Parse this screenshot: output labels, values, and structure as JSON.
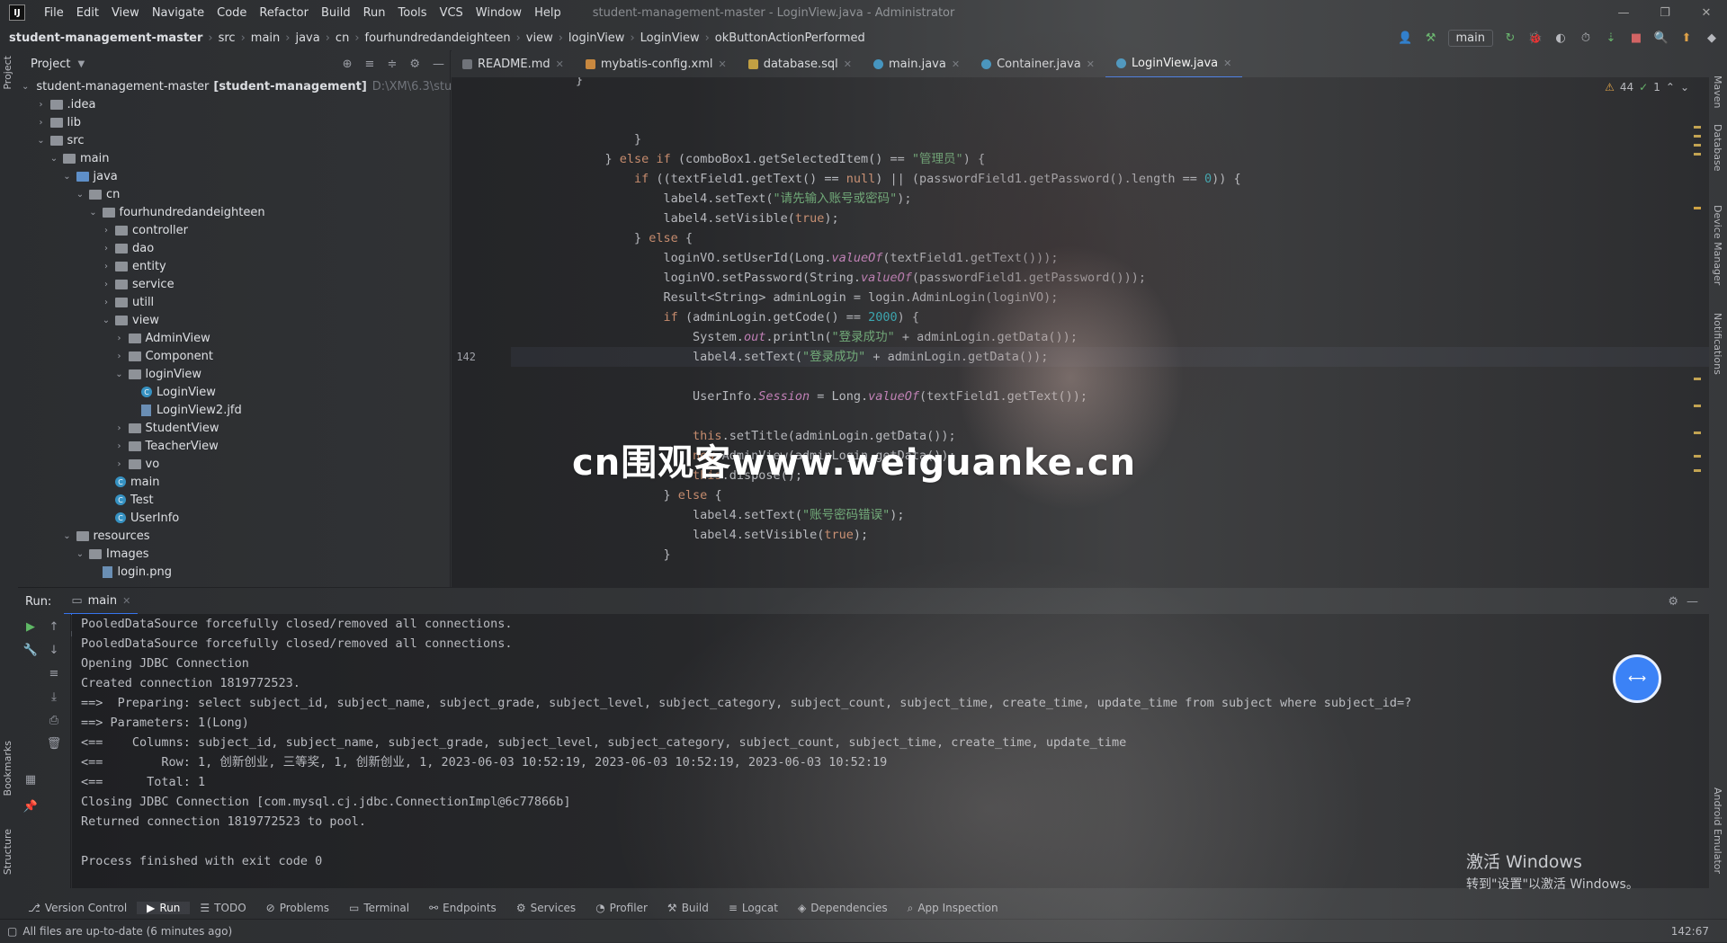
{
  "titlebar": {
    "logo": "IJ",
    "menu": [
      "File",
      "Edit",
      "View",
      "Navigate",
      "Code",
      "Refactor",
      "Build",
      "Run",
      "Tools",
      "VCS",
      "Window",
      "Help"
    ],
    "window_title": "student-management-master - LoginView.java - Administrator"
  },
  "navbar": {
    "breadcrumbs": [
      "student-management-master",
      "src",
      "main",
      "java",
      "cn",
      "fourhundredandeighteen",
      "view",
      "loginView",
      "LoginView",
      "okButtonActionPerformed"
    ],
    "branch": "main"
  },
  "project_panel": {
    "title": "Project",
    "root_label": "student-management-master",
    "root_module": "[student-management]",
    "root_path": "D:\\XM\\6.3\\student",
    "tree": [
      {
        "label": ".idea",
        "depth": 1,
        "kind": "folder",
        "expanded": false
      },
      {
        "label": "lib",
        "depth": 1,
        "kind": "folder",
        "expanded": false
      },
      {
        "label": "src",
        "depth": 1,
        "kind": "folder",
        "expanded": true
      },
      {
        "label": "main",
        "depth": 2,
        "kind": "folder",
        "expanded": true
      },
      {
        "label": "java",
        "depth": 3,
        "kind": "folder-blue",
        "expanded": true
      },
      {
        "label": "cn",
        "depth": 4,
        "kind": "folder",
        "expanded": true
      },
      {
        "label": "fourhundredandeighteen",
        "depth": 5,
        "kind": "folder",
        "expanded": true
      },
      {
        "label": "controller",
        "depth": 6,
        "kind": "folder",
        "expanded": false
      },
      {
        "label": "dao",
        "depth": 6,
        "kind": "folder",
        "expanded": false
      },
      {
        "label": "entity",
        "depth": 6,
        "kind": "folder",
        "expanded": false
      },
      {
        "label": "service",
        "depth": 6,
        "kind": "folder",
        "expanded": false
      },
      {
        "label": "utill",
        "depth": 6,
        "kind": "folder",
        "expanded": false
      },
      {
        "label": "view",
        "depth": 6,
        "kind": "folder",
        "expanded": true
      },
      {
        "label": "AdminView",
        "depth": 7,
        "kind": "folder",
        "expanded": false
      },
      {
        "label": "Component",
        "depth": 7,
        "kind": "folder",
        "expanded": false
      },
      {
        "label": "loginView",
        "depth": 7,
        "kind": "folder",
        "expanded": true
      },
      {
        "label": "LoginView",
        "depth": 8,
        "kind": "class"
      },
      {
        "label": "LoginView2.jfd",
        "depth": 8,
        "kind": "file"
      },
      {
        "label": "StudentView",
        "depth": 7,
        "kind": "folder",
        "expanded": false
      },
      {
        "label": "TeacherView",
        "depth": 7,
        "kind": "folder",
        "expanded": false
      },
      {
        "label": "vo",
        "depth": 7,
        "kind": "folder",
        "expanded": false
      },
      {
        "label": "main",
        "depth": 6,
        "kind": "class"
      },
      {
        "label": "Test",
        "depth": 6,
        "kind": "class"
      },
      {
        "label": "UserInfo",
        "depth": 6,
        "kind": "class"
      },
      {
        "label": "resources",
        "depth": 3,
        "kind": "folder",
        "expanded": true
      },
      {
        "label": "Images",
        "depth": 4,
        "kind": "folder",
        "expanded": true
      },
      {
        "label": "login.png",
        "depth": 5,
        "kind": "file"
      }
    ]
  },
  "editor_tabs": [
    {
      "label": "README.md",
      "icon": "md"
    },
    {
      "label": "mybatis-config.xml",
      "icon": "xml"
    },
    {
      "label": "database.sql",
      "icon": "sql"
    },
    {
      "label": "main.java",
      "icon": "class"
    },
    {
      "label": "Container.java",
      "icon": "class"
    },
    {
      "label": "LoginView.java",
      "icon": "class",
      "active": true
    }
  ],
  "inspections": {
    "warnings": "44",
    "ok": "1"
  },
  "editor": {
    "current_line": "142",
    "lines": [
      {
        "n": "",
        "html": "}"
      },
      {
        "n": "",
        "html": ""
      },
      {
        "n": "",
        "html": ""
      },
      {
        "n": "",
        "html": "        }"
      },
      {
        "n": "",
        "html": "    } else if (comboBox1.getSelectedItem() == \"管理员\") {"
      },
      {
        "n": "",
        "html": "        if ((textField1.getText() == null) || (passwordField1.getPassword().length == 0)) {"
      },
      {
        "n": "",
        "html": "            label4.setText(\"请先输入账号或密码\");"
      },
      {
        "n": "",
        "html": "            label4.setVisible(true);"
      },
      {
        "n": "",
        "html": "        } else {"
      },
      {
        "n": "",
        "html": "            loginVO.setUserId(Long.valueOf(textField1.getText()));"
      },
      {
        "n": "",
        "html": "            loginVO.setPassword(String.valueOf(passwordField1.getPassword()));"
      },
      {
        "n": "",
        "html": "            Result<String> adminLogin = login.AdminLogin(loginVO);"
      },
      {
        "n": "",
        "html": "            if (adminLogin.getCode() == 2000) {"
      },
      {
        "n": "",
        "html": "                System.out.println(\"登录成功\" + adminLogin.getData());"
      },
      {
        "n": "142",
        "html": "                label4.setText(\"登录成功\" + adminLogin.getData());"
      },
      {
        "n": "",
        "html": ""
      },
      {
        "n": "",
        "html": "                UserInfo.Session = Long.valueOf(textField1.getText());"
      },
      {
        "n": "",
        "html": ""
      },
      {
        "n": "",
        "html": "                this.setTitle(adminLogin.getData());"
      },
      {
        "n": "",
        "html": "                new AdminView(adminLogin.getData());"
      },
      {
        "n": "",
        "html": "                this.dispose();"
      },
      {
        "n": "",
        "html": "            } else {"
      },
      {
        "n": "",
        "html": "                label4.setText(\"账号密码错误\");"
      },
      {
        "n": "",
        "html": "                label4.setVisible(true);"
      },
      {
        "n": "",
        "html": "            }"
      },
      {
        "n": "",
        "html": ""
      }
    ]
  },
  "run_panel": {
    "label": "Run:",
    "tab": "main",
    "console": [
      "PooledDataSource forcefully closed/removed all connections.",
      "PooledDataSource forcefully closed/removed all connections.",
      "Opening JDBC Connection",
      "Created connection 1819772523.",
      "==>  Preparing: select subject_id, subject_name, subject_grade, subject_level, subject_category, subject_count, subject_time, create_time, update_time from subject where subject_id=?",
      "==> Parameters: 1(Long)",
      "<==    Columns: subject_id, subject_name, subject_grade, subject_level, subject_category, subject_count, subject_time, create_time, update_time",
      "<==        Row: 1, 创新创业, 三等奖, 1, 创新创业, 1, 2023-06-03 10:52:19, 2023-06-03 10:52:19, 2023-06-03 10:52:19",
      "<==      Total: 1",
      "Closing JDBC Connection [com.mysql.cj.jdbc.ConnectionImpl@6c77866b]",
      "Returned connection 1819772523 to pool.",
      "",
      "Process finished with exit code 0"
    ]
  },
  "bottom_tabs": [
    "Version Control",
    "Run",
    "TODO",
    "Problems",
    "Terminal",
    "Endpoints",
    "Services",
    "Profiler",
    "Build",
    "Logcat",
    "Dependencies",
    "App Inspection"
  ],
  "status": {
    "message": "All files are up-to-date (6 minutes ago)",
    "position": "142:67"
  },
  "left_strip": {
    "project": "Project",
    "bookmarks": "Bookmarks",
    "structure": "Structure"
  },
  "right_strip": {
    "maven": "Maven",
    "database": "Database",
    "device_manager": "Device Manager",
    "notifications": "Notifications",
    "emulator": "Android Emulator"
  },
  "activate_windows": {
    "line1": "激活 Windows",
    "line2": "转到\"设置\"以激活 Windows。"
  },
  "watermark": "cn围观客www.weiguanke.cn"
}
